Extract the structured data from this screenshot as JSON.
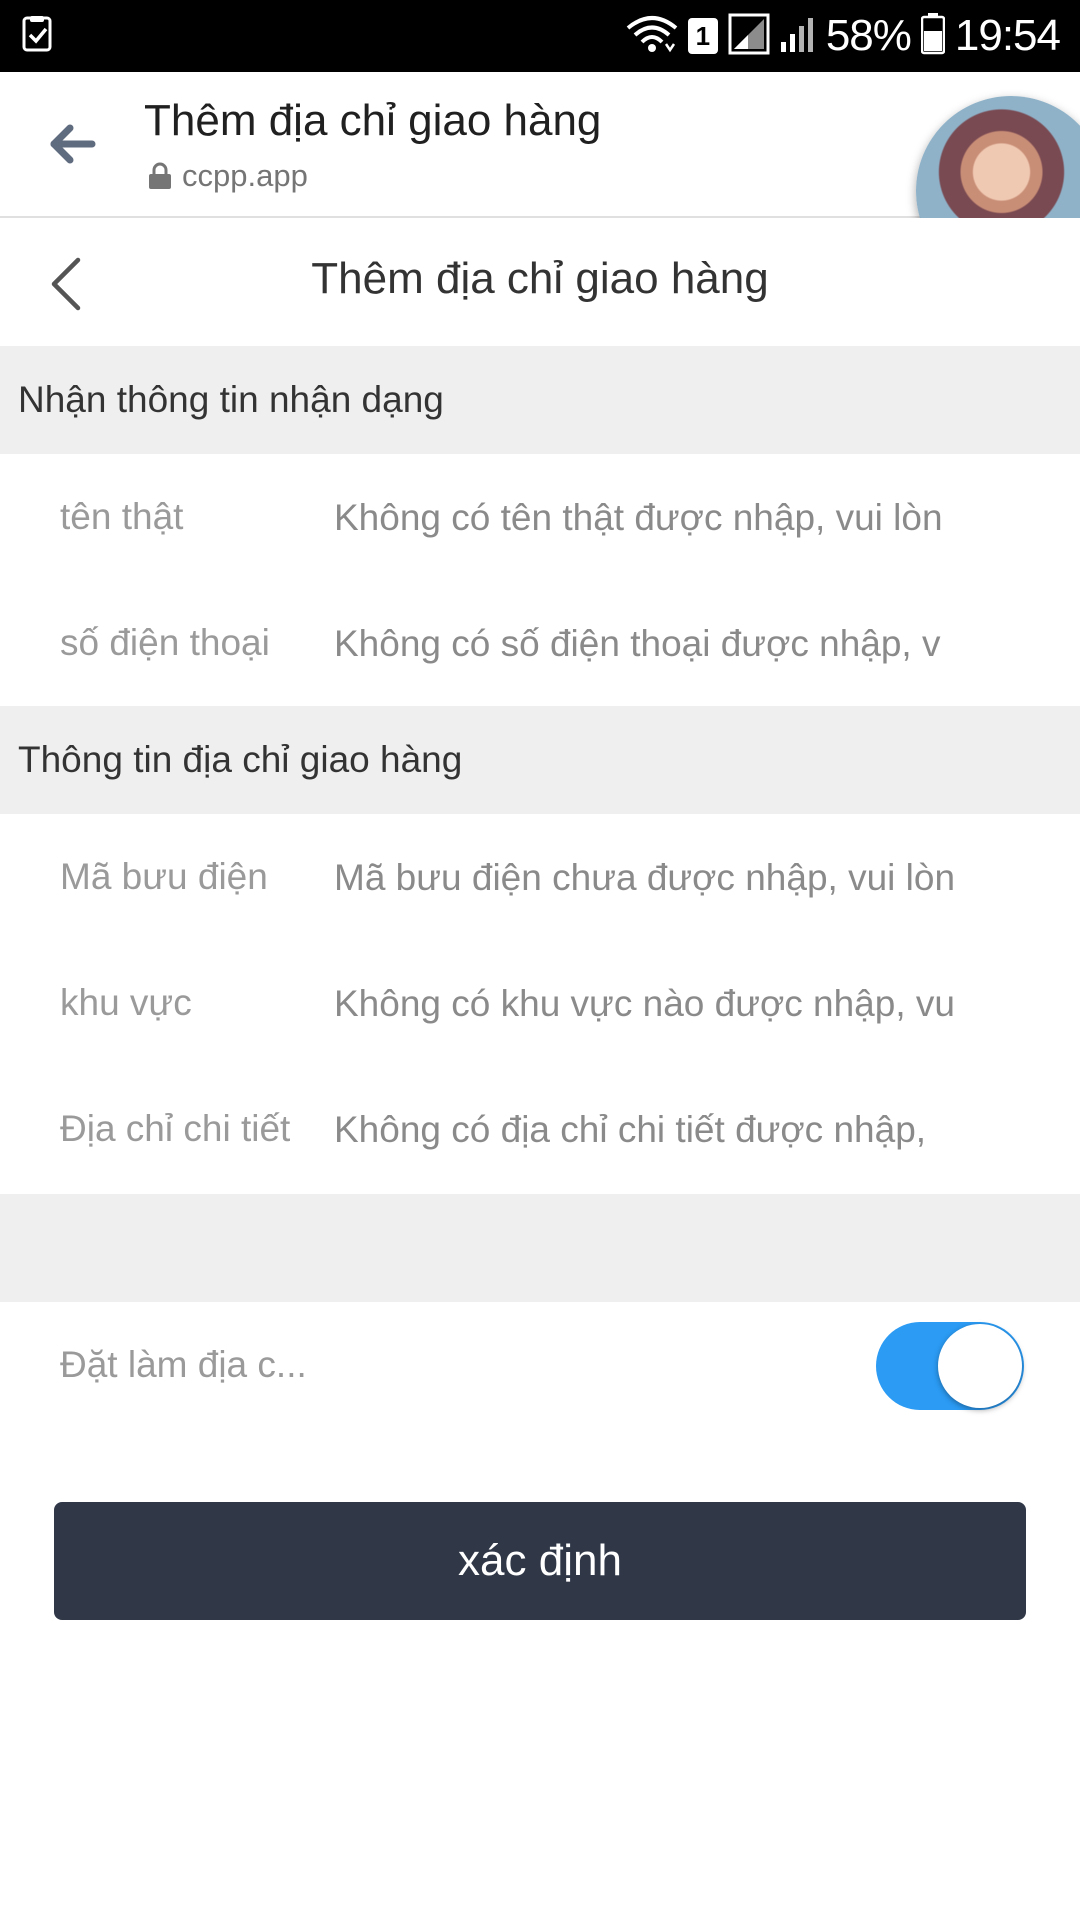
{
  "status_bar": {
    "battery": "58%",
    "time": "19:54",
    "sim_slot": "1"
  },
  "browser": {
    "title": "Thêm địa chỉ giao hàng",
    "url": "ccpp.app"
  },
  "page": {
    "title": "Thêm địa chỉ giao hàng"
  },
  "section_identity": {
    "title": "Nhận thông tin nhận dạng",
    "fields": [
      {
        "label": "tên thật",
        "placeholder": "Không có tên thật được nhập, vui lòn"
      },
      {
        "label": "số điện thoại",
        "placeholder": "Không có số điện thoại được nhập, v"
      }
    ]
  },
  "section_address": {
    "title": "Thông tin địa chỉ giao hàng",
    "fields": [
      {
        "label": "Mã bưu điện",
        "placeholder": "Mã bưu điện chưa được nhập, vui lòn"
      },
      {
        "label": "khu vực",
        "placeholder": "Không có khu vực nào được nhập, vu"
      },
      {
        "label": "Địa chỉ chi tiết",
        "placeholder": "Không có địa chỉ chi tiết được nhập,"
      }
    ]
  },
  "default_address": {
    "label": "Đặt làm địa c...",
    "enabled": true
  },
  "confirm_label": "xác định",
  "colors": {
    "accent": "#2b9bf4",
    "button": "#303848",
    "section_bg": "#efefef"
  },
  "icons": {
    "browser_back": "arrow-left-icon",
    "page_back": "chevron-left-icon",
    "lock": "lock-icon"
  }
}
